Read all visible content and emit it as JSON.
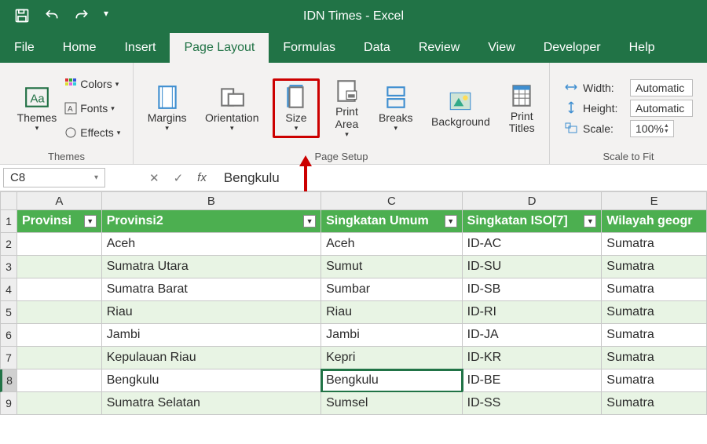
{
  "app": {
    "title": "IDN Times  -  Excel"
  },
  "tabs": {
    "file": "File",
    "home": "Home",
    "insert": "Insert",
    "page_layout": "Page Layout",
    "formulas": "Formulas",
    "data": "Data",
    "review": "Review",
    "view": "View",
    "developer": "Developer",
    "help": "Help"
  },
  "ribbon": {
    "themes": {
      "label": "Themes",
      "btn": "Themes",
      "colors": "Colors",
      "fonts": "Fonts",
      "effects": "Effects"
    },
    "page_setup": {
      "label": "Page Setup",
      "margins": "Margins",
      "orientation": "Orientation",
      "size": "Size",
      "print_area": "Print\nArea",
      "breaks": "Breaks",
      "background": "Background",
      "print_titles": "Print\nTitles"
    },
    "scale": {
      "label": "Scale to Fit",
      "width": "Width:",
      "height": "Height:",
      "scale": "Scale:",
      "auto": "Automatic",
      "pct": "100%"
    }
  },
  "formula_bar": {
    "cell_ref": "C8",
    "fx": "fx",
    "value": "Bengkulu"
  },
  "columns": {
    "A": "A",
    "B": "B",
    "C": "C",
    "D": "D",
    "E": "E"
  },
  "headers": {
    "A": "Provinsi",
    "B": "Provinsi2",
    "C": "Singkatan Umum",
    "D": "Singkatan ISO[7]",
    "E": "Wilayah geogr"
  },
  "rows": [
    {
      "n": "1"
    },
    {
      "n": "2",
      "B": "Aceh",
      "C": "Aceh",
      "D": "ID-AC",
      "E": "Sumatra"
    },
    {
      "n": "3",
      "B": "Sumatra Utara",
      "C": "Sumut",
      "D": "ID-SU",
      "E": "Sumatra"
    },
    {
      "n": "4",
      "B": "Sumatra Barat",
      "C": "Sumbar",
      "D": "ID-SB",
      "E": "Sumatra"
    },
    {
      "n": "5",
      "B": "Riau",
      "C": "Riau",
      "D": "ID-RI",
      "E": "Sumatra"
    },
    {
      "n": "6",
      "B": "Jambi",
      "C": "Jambi",
      "D": "ID-JA",
      "E": "Sumatra"
    },
    {
      "n": "7",
      "B": "Kepulauan Riau",
      "C": "Kepri",
      "D": "ID-KR",
      "E": "Sumatra"
    },
    {
      "n": "8",
      "B": "Bengkulu",
      "C": "Bengkulu",
      "D": "ID-BE",
      "E": "Sumatra"
    },
    {
      "n": "9",
      "B": "Sumatra Selatan",
      "C": "Sumsel",
      "D": "ID-SS",
      "E": "Sumatra"
    }
  ]
}
